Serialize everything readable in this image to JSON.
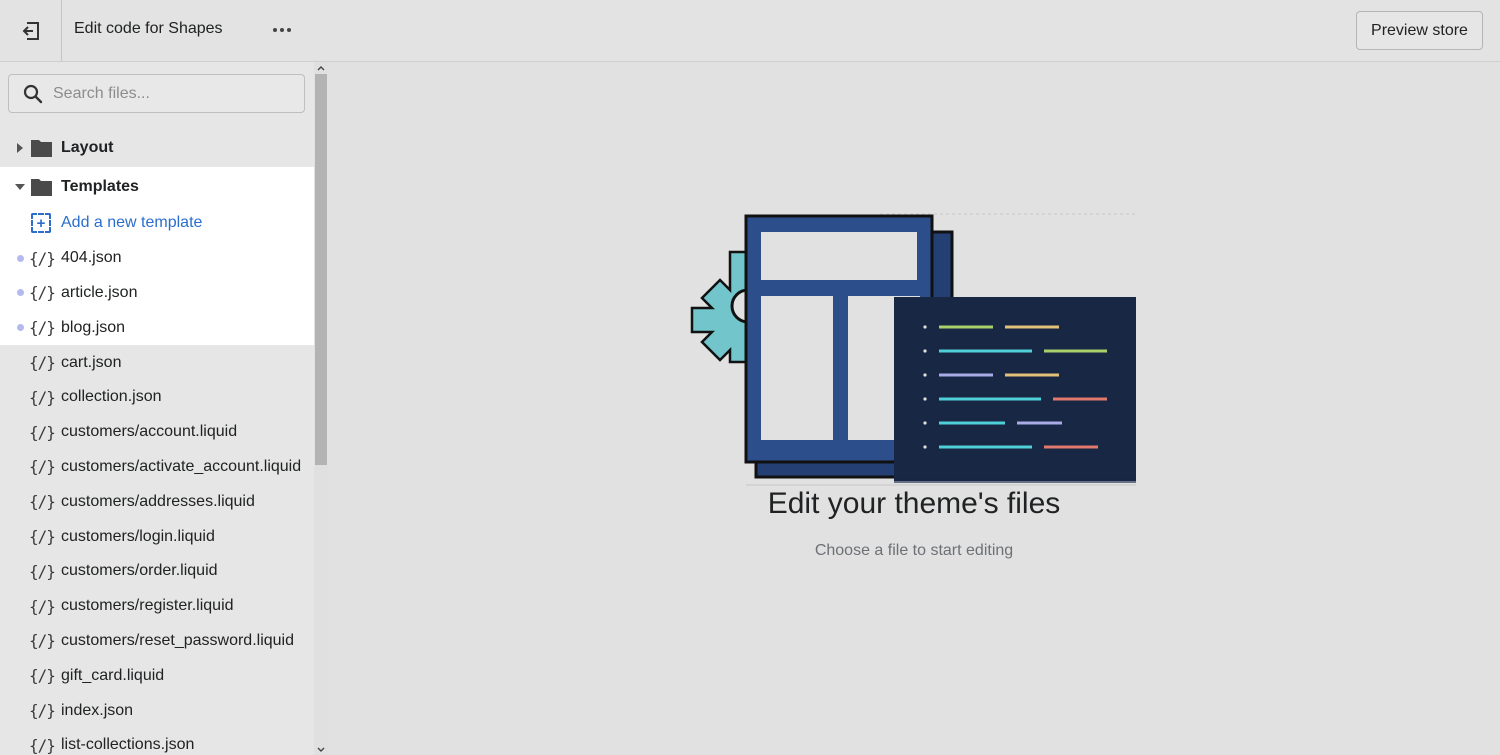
{
  "topbar": {
    "back_icon": "exit-arrow-icon",
    "title": "Edit code for Shapes",
    "more_icon": "ellipsis-icon",
    "preview_label": "Preview store"
  },
  "sidebar": {
    "search": {
      "placeholder": "Search files...",
      "value": "",
      "icon": "search-icon"
    },
    "folders": [
      {
        "name": "Layout",
        "expanded": false
      },
      {
        "name": "Templates",
        "expanded": true
      }
    ],
    "add_template_label": "Add a new template",
    "files": [
      {
        "name": "404.json",
        "modified": true
      },
      {
        "name": "article.json",
        "modified": true
      },
      {
        "name": "blog.json",
        "modified": true
      },
      {
        "name": "cart.json",
        "modified": false
      },
      {
        "name": "collection.json",
        "modified": false
      },
      {
        "name": "customers/account.liquid",
        "modified": false
      },
      {
        "name": "customers/activate_account.liquid",
        "modified": false
      },
      {
        "name": "customers/addresses.liquid",
        "modified": false
      },
      {
        "name": "customers/login.liquid",
        "modified": false
      },
      {
        "name": "customers/order.liquid",
        "modified": false
      },
      {
        "name": "customers/register.liquid",
        "modified": false
      },
      {
        "name": "customers/reset_password.liquid",
        "modified": false
      },
      {
        "name": "gift_card.liquid",
        "modified": false
      },
      {
        "name": "index.json",
        "modified": false
      },
      {
        "name": "list-collections.json",
        "modified": false
      }
    ],
    "file_icon_glyph": "{/}"
  },
  "main": {
    "empty_title": "Edit your theme's files",
    "empty_subtitle": "Choose a file to start editing"
  },
  "colors": {
    "link": "#2c6ecb",
    "modified_dot": "#b4b9f0",
    "illustration_blue": "#2c4f8c",
    "illustration_navy": "#172744",
    "gear_teal": "#73c5cc"
  }
}
